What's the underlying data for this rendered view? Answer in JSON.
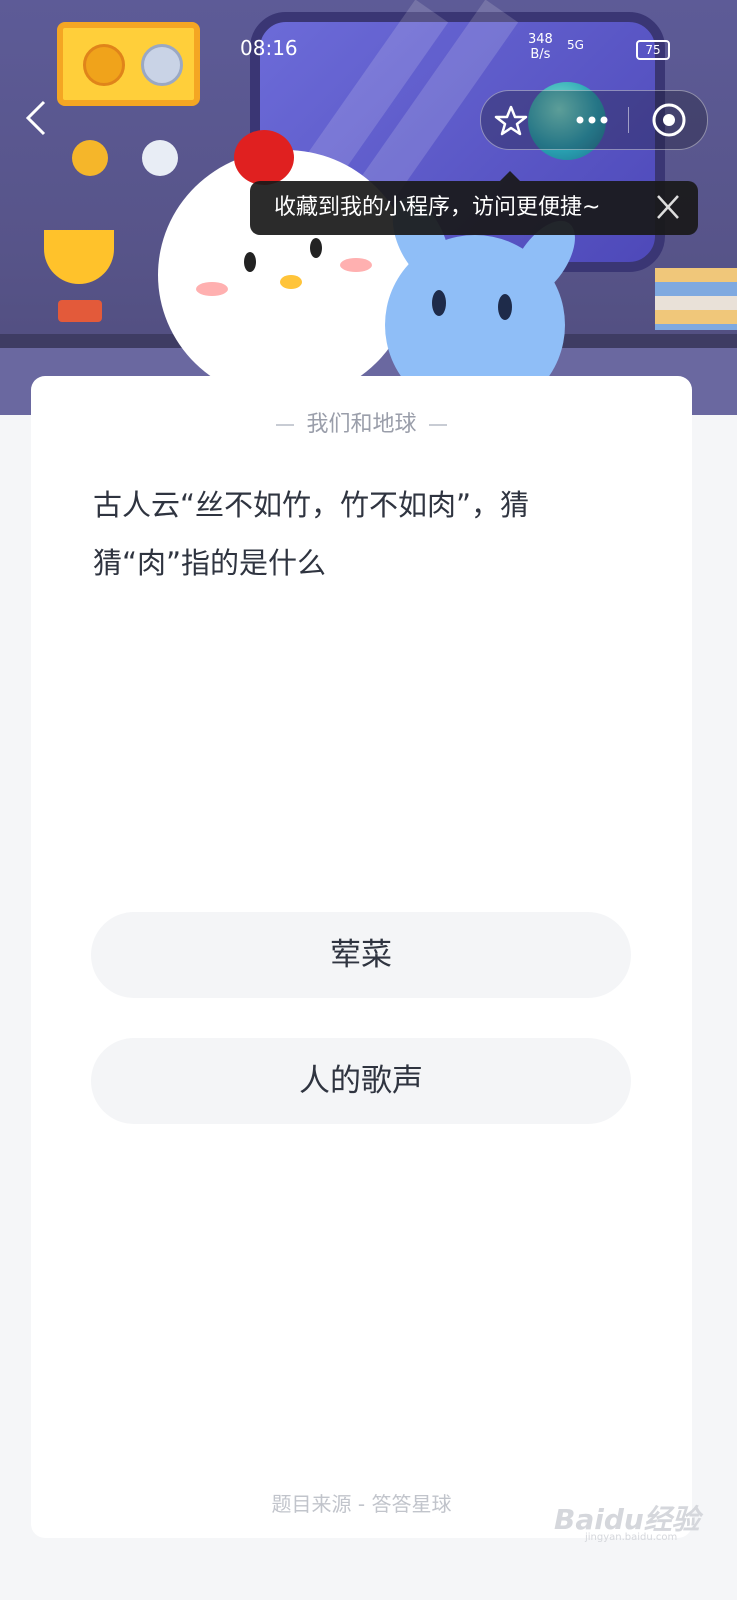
{
  "status_bar": {
    "time": "08:16",
    "net_speed_value": "348",
    "net_speed_unit": "B/s",
    "network_type": "5G",
    "battery": "75"
  },
  "nav": {
    "back_icon": "chevron-left-icon",
    "capsule": {
      "favorite_icon": "star-icon",
      "more_icon": "more-dots-icon",
      "close_icon": "target-circle-icon"
    }
  },
  "tooltip": {
    "text": "收藏到我的小程序，访问更便捷~",
    "close_icon": "close-icon"
  },
  "card": {
    "category": "我们和地球",
    "question_line1": "古人云“丝不如竹，竹不如肉”，猜",
    "question_line2": "猜“肉”指的是什么",
    "options": [
      {
        "label": "荤菜"
      },
      {
        "label": "人的歌声"
      }
    ],
    "source": "题目来源 - 答答星球"
  },
  "watermark": {
    "brand": "Baidu经验",
    "url": "jingyan.baidu.com"
  },
  "colors": {
    "hero_bg": "#5d5b97",
    "card_bg": "#ffffff",
    "option_bg": "#f4f5f7",
    "text_primary": "#2f3440",
    "text_muted": "#9a9eaa"
  }
}
